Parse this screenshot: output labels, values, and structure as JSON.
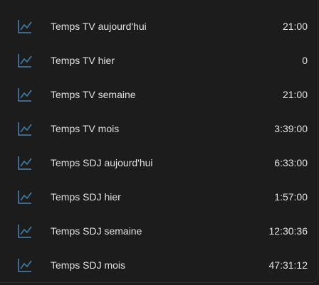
{
  "colors": {
    "background": "#1c1c1c",
    "text": "#e1e1e1",
    "icon": "#44739e"
  },
  "entities": [
    {
      "icon": "chart-line-icon",
      "label": "Temps TV aujourd'hui",
      "value": "21:00"
    },
    {
      "icon": "chart-line-icon",
      "label": "Temps TV hier",
      "value": "0"
    },
    {
      "icon": "chart-line-icon",
      "label": "Temps TV semaine",
      "value": "21:00"
    },
    {
      "icon": "chart-line-icon",
      "label": "Temps TV mois",
      "value": "3:39:00"
    },
    {
      "icon": "chart-line-icon",
      "label": "Temps SDJ aujourd'hui",
      "value": "6:33:00"
    },
    {
      "icon": "chart-line-icon",
      "label": "Temps SDJ hier",
      "value": "1:57:00"
    },
    {
      "icon": "chart-line-icon",
      "label": "Temps SDJ semaine",
      "value": "12:30:36"
    },
    {
      "icon": "chart-line-icon",
      "label": "Temps SDJ mois",
      "value": "47:31:12"
    }
  ]
}
